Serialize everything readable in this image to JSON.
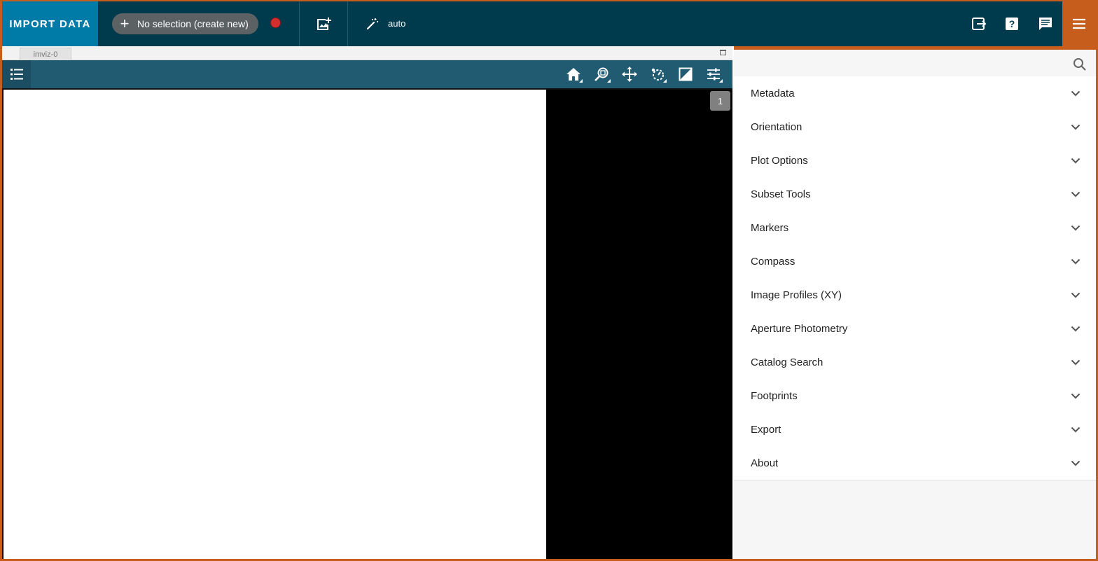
{
  "topbar": {
    "import_label": "IMPORT DATA",
    "subset_label": "No selection (create new)",
    "subset_plus": "+",
    "link_mode": "auto",
    "icons": [
      "plus-icon",
      "record-icon",
      "add-image-icon",
      "magic-wand-icon",
      "export-icon",
      "help-icon",
      "comment-icon",
      "menu-icon"
    ]
  },
  "viewer": {
    "tab_label": "imviz-0",
    "layer_count": "1",
    "toolbar_icons": [
      "layers-list-icon",
      "home-icon",
      "zoom-icon",
      "pan-icon",
      "rotate-icon",
      "contrast-icon",
      "sliders-icon"
    ]
  },
  "tray": {
    "search_placeholder": "",
    "plugins": [
      {
        "label": "Metadata"
      },
      {
        "label": "Orientation"
      },
      {
        "label": "Plot Options"
      },
      {
        "label": "Subset Tools"
      },
      {
        "label": "Markers"
      },
      {
        "label": "Compass"
      },
      {
        "label": "Image Profiles (XY)"
      },
      {
        "label": "Aperture Photometry"
      },
      {
        "label": "Catalog Search"
      },
      {
        "label": "Footprints"
      },
      {
        "label": "Export"
      },
      {
        "label": "About"
      }
    ]
  },
  "colors": {
    "topbar": "#003b4d",
    "import_button": "#007ba8",
    "accent": "#c75d1c",
    "viewer_toolbar": "#205b72"
  }
}
